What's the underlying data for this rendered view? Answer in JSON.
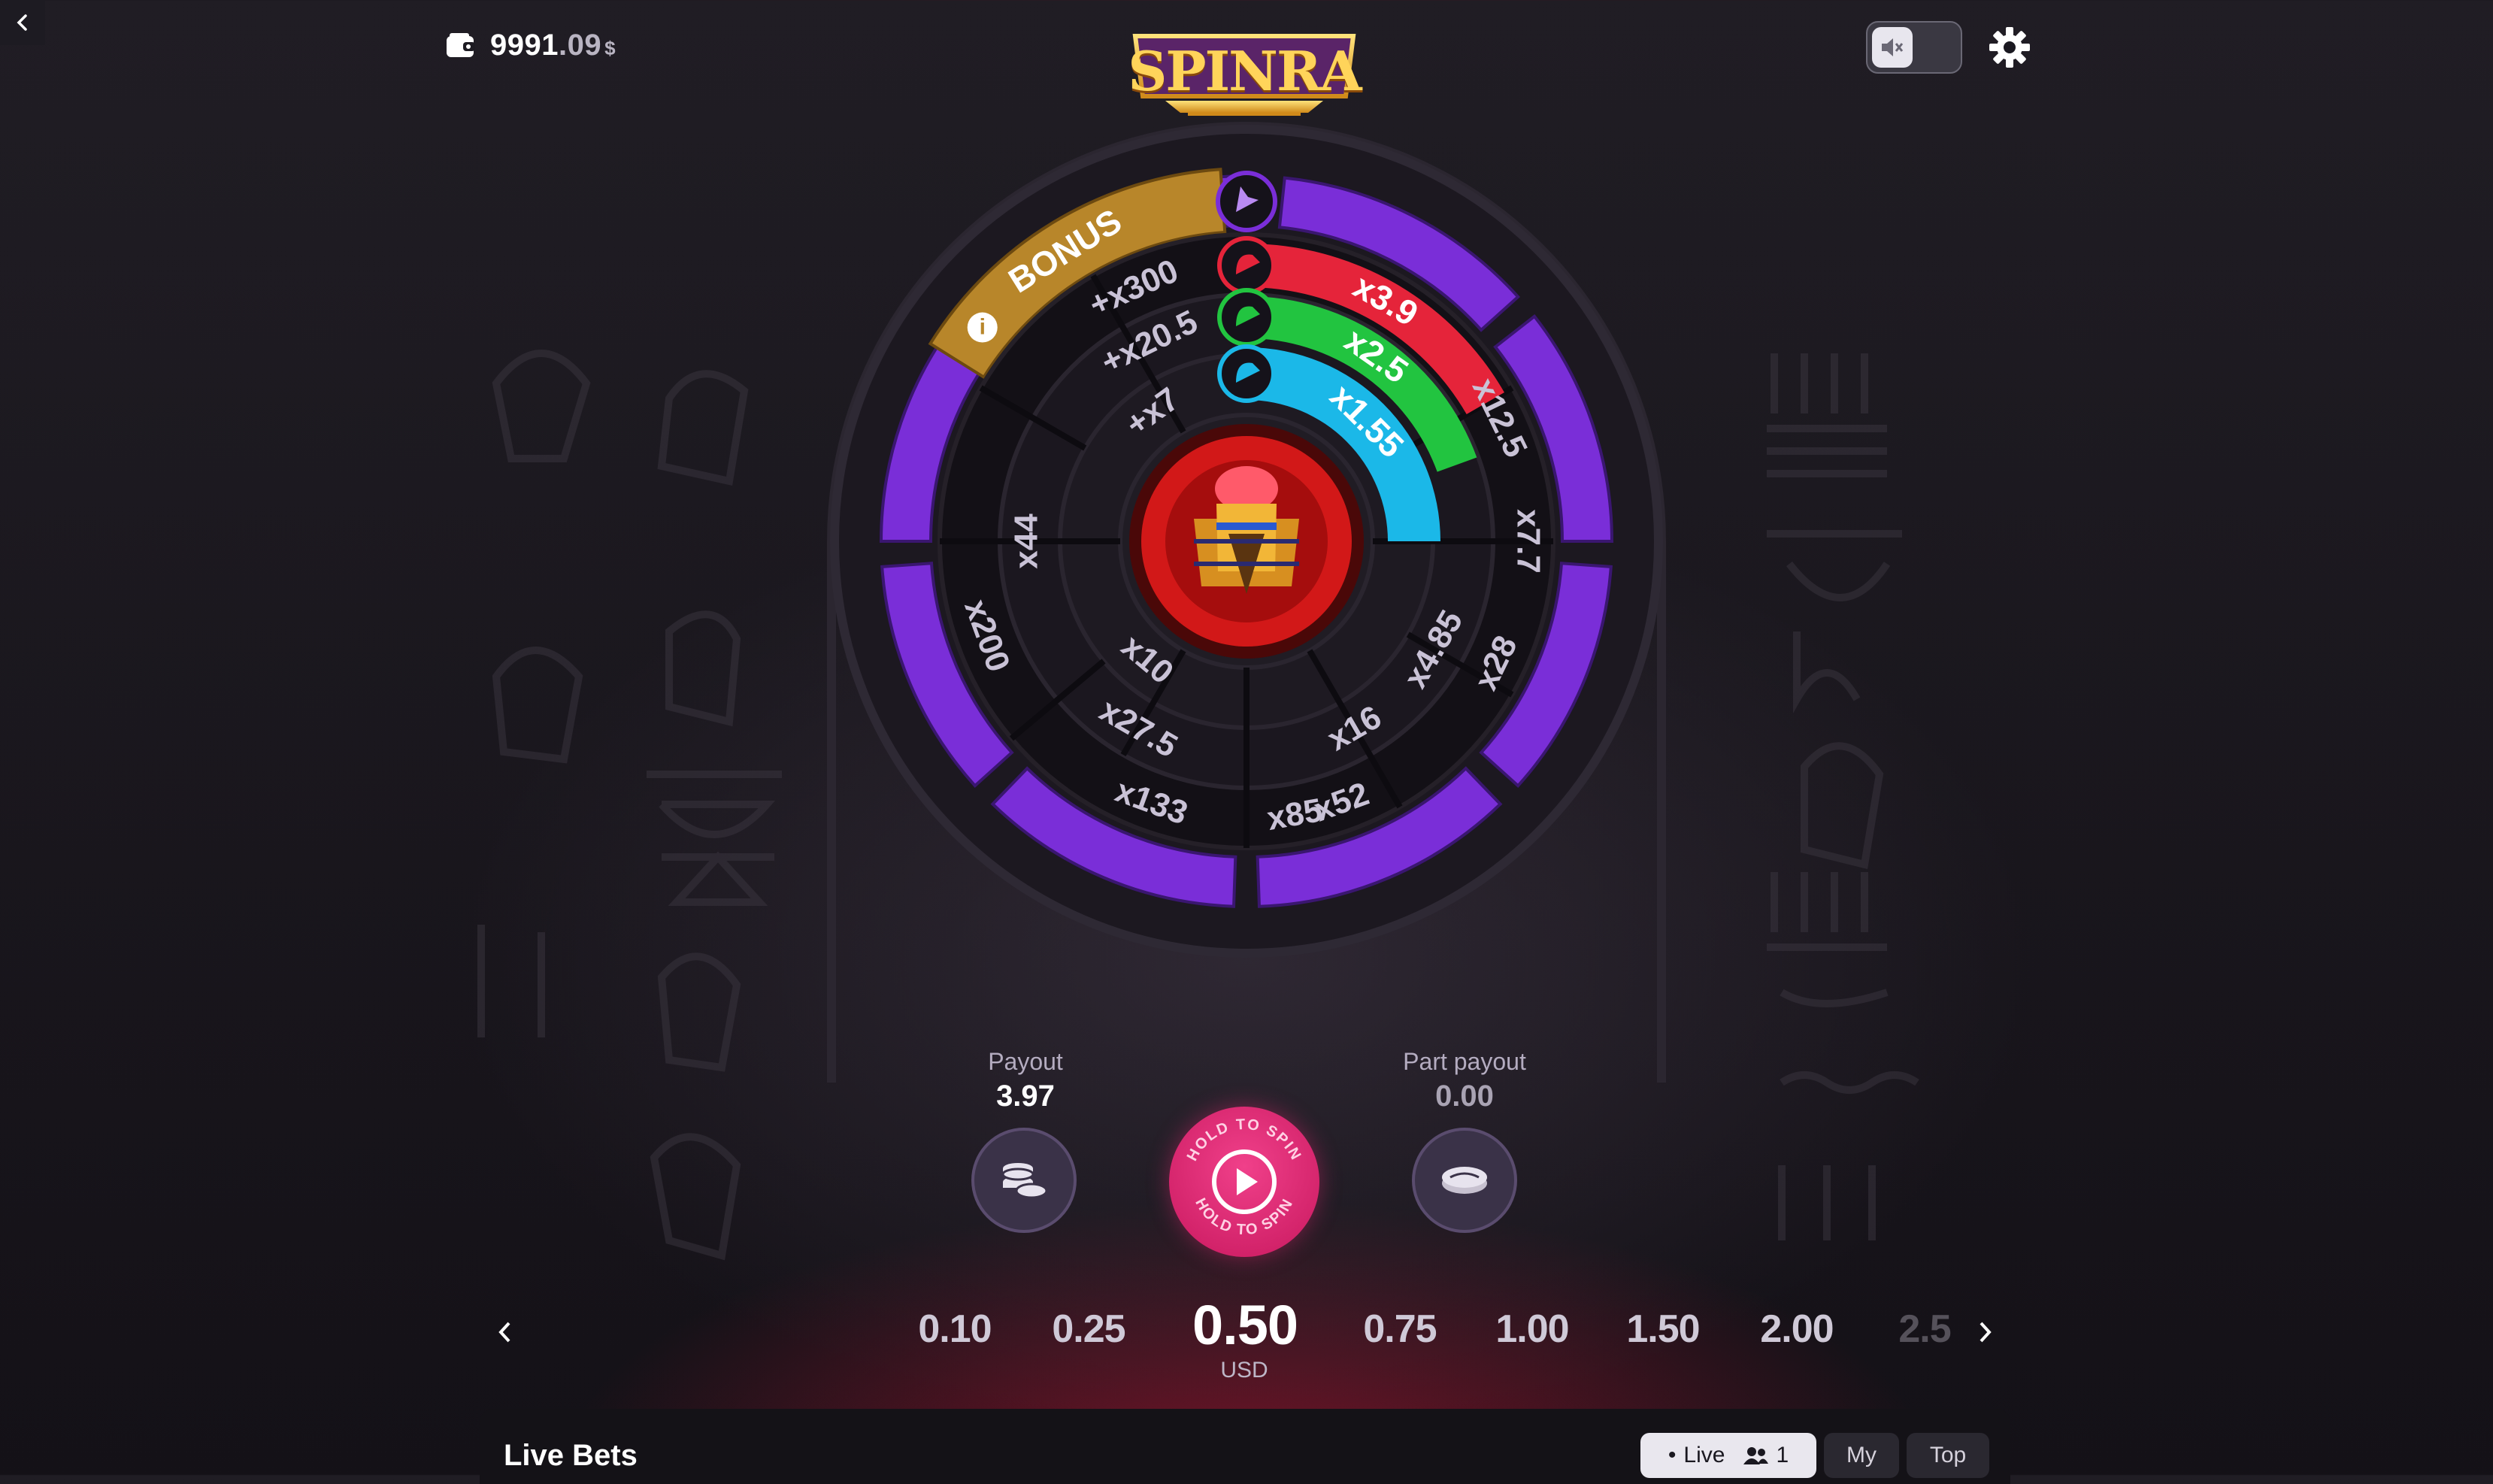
{
  "header": {
    "balance_int": "9991",
    "balance_dec": ".09",
    "currency_symbol": "$",
    "logo_text": "SPINRA",
    "icons": [
      "back-arrow-icon",
      "wallet-icon",
      "sound-muted-icon",
      "gear-icon"
    ]
  },
  "wheel": {
    "bonus_label": "BONUS",
    "bonus_info_glyph": "i",
    "outer_ring": [
      "x200",
      "x133",
      "x85",
      "x52",
      "x28",
      "x7.7",
      "x12.5"
    ],
    "middle_ring": [
      "+x300",
      "x44",
      "x27.5",
      "x16",
      "x4.85"
    ],
    "inner_ring": [
      "+x20.5",
      "+x7",
      "x10"
    ],
    "arcs": [
      {
        "label": "x3.9",
        "color": "#e5243a",
        "icon": "bird-head-icon"
      },
      {
        "label": "x2.5",
        "color": "#22c440",
        "icon": "crocodile-head-icon"
      },
      {
        "label": "x1.55",
        "color": "#1bb8e8",
        "icon": "cat-head-icon"
      }
    ],
    "top_icon": "jackal-head-icon",
    "center": "pharaoh-falcon-icon",
    "colors": {
      "purple": "#7a2ed8",
      "gold": "#b8862a",
      "ring_dark": "#16131b"
    }
  },
  "payout": {
    "label": "Payout",
    "value": "3.97"
  },
  "part_payout": {
    "label": "Part payout",
    "value": "0.00"
  },
  "spin_button": {
    "label": "HOLD TO SPIN"
  },
  "bets": {
    "values": [
      "0.10",
      "0.25",
      "0.50",
      "0.75",
      "1.00",
      "1.50",
      "2.00",
      "2.5"
    ],
    "selected": "0.50",
    "currency": "USD"
  },
  "live_bets": {
    "title": "Live Bets",
    "tabs": [
      {
        "label": "Live",
        "count": "1"
      },
      {
        "label": "My"
      },
      {
        "label": "Top"
      }
    ]
  }
}
